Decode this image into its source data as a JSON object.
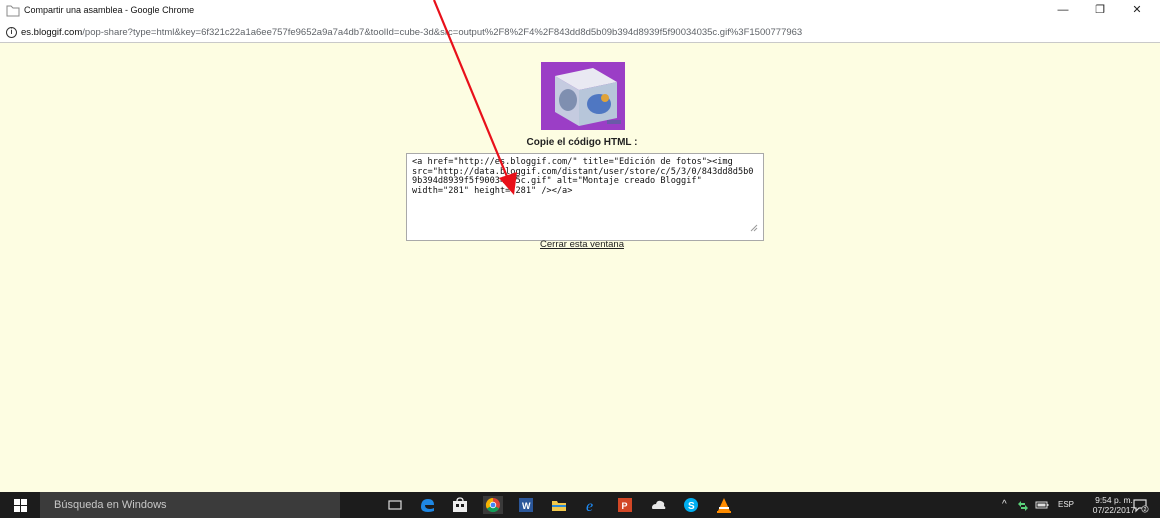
{
  "window": {
    "title": "Compartir una asamblea - Google Chrome",
    "controls": {
      "minimize": "—",
      "restore": "❐",
      "close": "✕"
    }
  },
  "addressbar": {
    "info_icon": "info-icon",
    "domain": "es.bloggif.com",
    "path": "/pop-share?type=html&key=6f321c22a1a6ee757fe9652a9a7a4db7&toolId=cube-3d&src=output%2F8%2F4%2F843dd8d5b09b394d8939f5f90034035c.gif%3F1500777963"
  },
  "page": {
    "heading": "Copie el código HTML :",
    "html_code": "<a href=\"http://es.bloggif.com/\" title=\"Edición de fotos\"><img src=\"http://data.bloggif.com/distant/user/store/c/5/3/0/843dd8d5b09b394d8939f5f90034035c.gif\" alt=\"Montaje creado Bloggif\" width=\"281\" height=\"281\" /></a>",
    "close_link": "Cerrar esta ventana"
  },
  "annotation": {
    "color": "#e8101a",
    "icon": "red-arrow-annotation"
  },
  "taskbar": {
    "search_placeholder": "Búsqueda en Windows",
    "apps": [
      "task-view-icon",
      "edge-icon",
      "store-icon",
      "chrome-icon",
      "word-icon",
      "file-explorer-icon",
      "internet-explorer-icon",
      "powerpoint-icon",
      "cloud-app-icon",
      "skype-icon",
      "vlc-icon"
    ],
    "tray": {
      "chevron": "^",
      "language": "ESP",
      "time": "9:54 p. m.",
      "date": "07/22/2017",
      "notifications_badge": "2"
    }
  }
}
